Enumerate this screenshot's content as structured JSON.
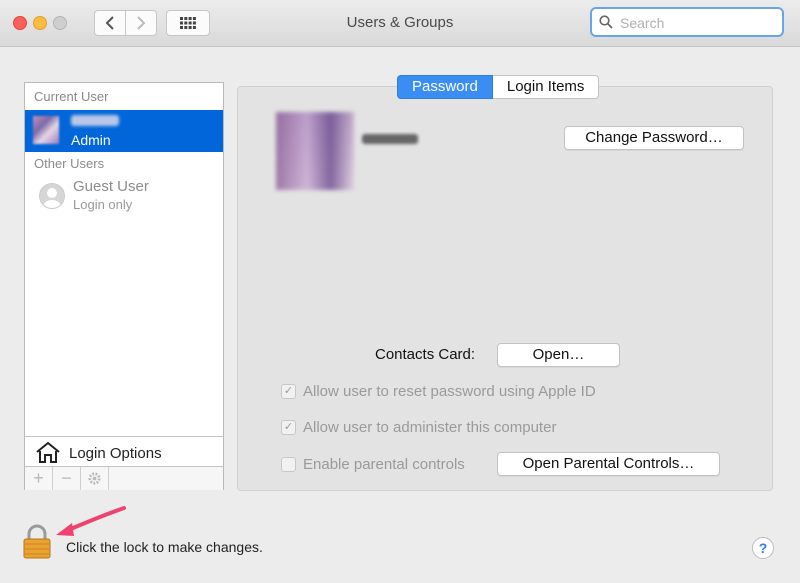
{
  "window": {
    "title": "Users & Groups"
  },
  "search": {
    "placeholder": "Search"
  },
  "sidebar": {
    "current_user_header": "Current User",
    "current_user": {
      "role": "Admin"
    },
    "other_users_header": "Other Users",
    "guest": {
      "name": "Guest User",
      "sub": "Login only"
    },
    "login_options": "Login Options",
    "buttons": {
      "add": "+",
      "remove": "−"
    }
  },
  "tabs": [
    {
      "label": "Password",
      "active": true
    },
    {
      "label": "Login Items",
      "active": false
    }
  ],
  "panel": {
    "change_password": "Change Password…",
    "contacts_card_label": "Contacts Card:",
    "open_button": "Open…",
    "checkboxes": [
      {
        "label": "Allow user to reset password using Apple ID",
        "checked": true
      },
      {
        "label": "Allow user to administer this computer",
        "checked": true
      },
      {
        "label": "Enable parental controls",
        "checked": false
      }
    ],
    "open_parental_controls": "Open Parental Controls…"
  },
  "footer": {
    "lock_text": "Click the lock to make changes.",
    "help": "?"
  },
  "colors": {
    "accent": "#3a8ef3",
    "selection": "#0066d9",
    "arrow": "#f0426e"
  }
}
